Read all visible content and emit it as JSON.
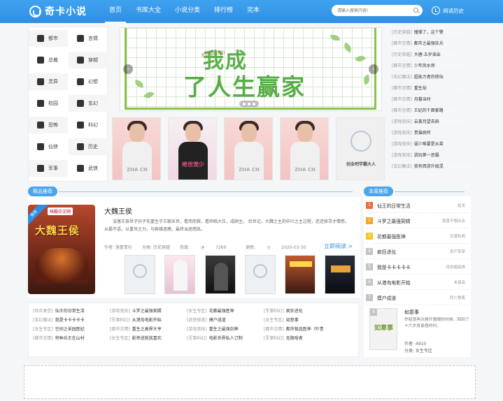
{
  "header": {
    "logo": "奇卡小说",
    "nav": [
      "首页",
      "书库大全",
      "小说分类",
      "排行榜",
      "完本"
    ],
    "active_nav": 0,
    "search_placeholder": "请输入搜索内容!",
    "history": "阅读历史"
  },
  "categories": [
    "都市",
    "言情",
    "总裁",
    "穿越",
    "灵异",
    "幻想",
    "校园",
    "玄幻",
    "恐怖",
    "科幻",
    "仙侠",
    "历史",
    "军事",
    "武侠"
  ],
  "banner": {
    "subtitle": "天尽相思(篇)",
    "line1": "我成",
    "line2": "了人生赢家"
  },
  "cover_texts": [
    "ZHA CN",
    "绝世宠少",
    "ZHA CN",
    "ZHA CN",
    "创业吧学霸大人"
  ],
  "news": [
    {
      "tag": "[历史穿越]",
      "title": "撞撑了，这个警"
    },
    {
      "tag": "[都市言情]",
      "title": "都市之最强狂兵"
    },
    {
      "tag": "[历史穿越]",
      "title": "大唐:五岁诶出"
    },
    {
      "tag": "[都市言情]",
      "title": "少年风水师"
    },
    {
      "tag": "[玄幻魔法]",
      "title": "超能力者的修仙"
    },
    {
      "tag": "[都市言情]",
      "title": "重生劫"
    },
    {
      "tag": "[都市言情]",
      "title": "月暮当时"
    },
    {
      "tag": "[都市言情]",
      "title": "王妃的千面套路"
    },
    {
      "tag": "[游戏竞技]",
      "title": "云裳月望去辰"
    },
    {
      "tag": "[游戏竞技]",
      "title": "贵猫病所"
    },
    {
      "tag": "[游戏竞技]",
      "title": "弱少唯要是从菜"
    },
    {
      "tag": "[游戏竞技]",
      "title": "游玩第一恶霸"
    },
    {
      "tag": "[玄幻魔法]",
      "title": "我有西游升级混"
    }
  ],
  "featured": {
    "section_label": "精品推荐",
    "book_title": "大魏王侯",
    "cover_title": "大魏王侯",
    "publisher": "咪酷中文网",
    "ribbon": "推荐",
    "description": "没落王族世子孙子先重生于王朝末世，看而而救，看师临大位，成顾主。 后世记，大魏之主的中兴之主过程，还还探寻才情感，从霸不语，以重世之力，与群雄逐鹿，最终当逐感凯。",
    "author": "作者: 洛重青衫",
    "category": "分类: 历史穿越",
    "heat": "热度:",
    "heat_value": "7269",
    "updated": "更新:",
    "updated_value": "2020-03-30",
    "read_now": "立即阅读 >"
  },
  "grid": [
    [
      {
        "tag": "[综合类型]",
        "title": "仙王的日常生活"
      },
      {
        "tag": "[游戏竞技]",
        "title": "斗罗之最强契婿"
      },
      {
        "tag": "[女生专区]",
        "title": "花都最强医神"
      },
      {
        "tag": "[军事科幻]",
        "title": "疯狂进化"
      }
    ],
    [
      {
        "tag": "[玄幻魔法]",
        "title": "我是卡卡卡卡卡"
      },
      {
        "tag": "[军事科幻]",
        "title": "从港岛电影开始"
      },
      {
        "tag": "[武侠修真]",
        "title": "摸户成道"
      },
      {
        "tag": "[女生专区]",
        "title": "如意事"
      }
    ],
    [
      {
        "tag": "[女生专区]",
        "title": "空间之采园医妃"
      },
      {
        "tag": "[都市言情]",
        "title": "重生之高界大亨"
      },
      {
        "tag": "[游戏竞技]",
        "title": "重生之最强剑神"
      },
      {
        "tag": "[都市言情]",
        "title": "都市极品医神（叶贵"
      }
    ],
    [
      {
        "tag": "[都市言情]",
        "title": "特种兵王在山村"
      },
      {
        "tag": "[女生专区]",
        "title": "影帝进就我喜欢"
      },
      {
        "tag": "[军事科幻]",
        "title": "电影世界私人订制"
      },
      {
        "tag": "[军事科幻]",
        "title": "无限啥者"
      }
    ]
  ],
  "ranking": {
    "section_label": "本周推荐",
    "items": [
      {
        "num": "1",
        "title": "仙王的日常生活",
        "tag": "枯龙"
      },
      {
        "num": "2",
        "title": "斗罗之最强契婿",
        "tag": "我喜不想出名"
      },
      {
        "num": "3",
        "title": "花都最强医神",
        "tag": "月落秋明"
      },
      {
        "num": "4",
        "title": "疯狂进化",
        "tag": "资产草草"
      },
      {
        "num": "5",
        "title": "我是卡卡卡卡卡",
        "tag": "连衣裙高扬"
      },
      {
        "num": "6",
        "title": "从港岛电影开始",
        "tag": "未孤高"
      },
      {
        "num": "7",
        "title": "摸户成道",
        "tag": "死亡数客"
      }
    ],
    "top_num": "8",
    "top_title": "如意事",
    "top_cover_text": "如意事",
    "top_desc": "乔昭意再次换开题眼的时候，回到了十六岁身最怪的时。",
    "top_author": "作者: 4910",
    "top_category": "分类: 女生专区",
    "colors": {
      "1": "#f06b3a",
      "2": "#f5a623",
      "3": "#f5c623"
    }
  }
}
